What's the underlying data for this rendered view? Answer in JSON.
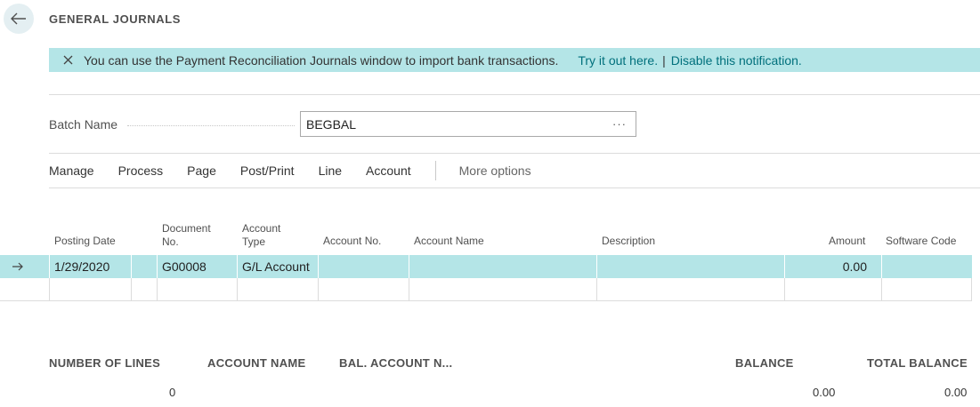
{
  "header": {
    "title": "GENERAL JOURNALS"
  },
  "notification": {
    "message": "You can use the Payment Reconciliation Journals window to import bank transactions.",
    "try_link": "Try it out here.",
    "separator": "|",
    "disable_link": "Disable this notification."
  },
  "batch": {
    "label": "Batch Name",
    "value": "BEGBAL",
    "lookup": "···"
  },
  "actions": {
    "items": [
      "Manage",
      "Process",
      "Page",
      "Post/Print",
      "Line",
      "Account"
    ],
    "more": "More options"
  },
  "grid": {
    "columns": {
      "posting_date": "Posting Date",
      "document_no_1": "Document",
      "document_no_2": "No.",
      "account_type_1": "Account",
      "account_type_2": "Type",
      "account_no": "Account No.",
      "account_name": "Account Name",
      "description": "Description",
      "amount": "Amount",
      "software_code": "Software Code"
    },
    "rows": [
      {
        "posting_date": "1/29/2020",
        "document_no": "G00008",
        "account_type": "G/L Account",
        "account_no": "",
        "account_name": "",
        "description": "",
        "amount": "0.00",
        "software_code": ""
      }
    ]
  },
  "footer": {
    "number_of_lines_label": "NUMBER OF LINES",
    "number_of_lines_value": "0",
    "account_name_label": "ACCOUNT NAME",
    "bal_account_label": "BAL. ACCOUNT N...",
    "balance_label": "BALANCE",
    "balance_value": "0.00",
    "total_balance_label": "TOTAL BALANCE",
    "total_balance_value": "0.00"
  }
}
